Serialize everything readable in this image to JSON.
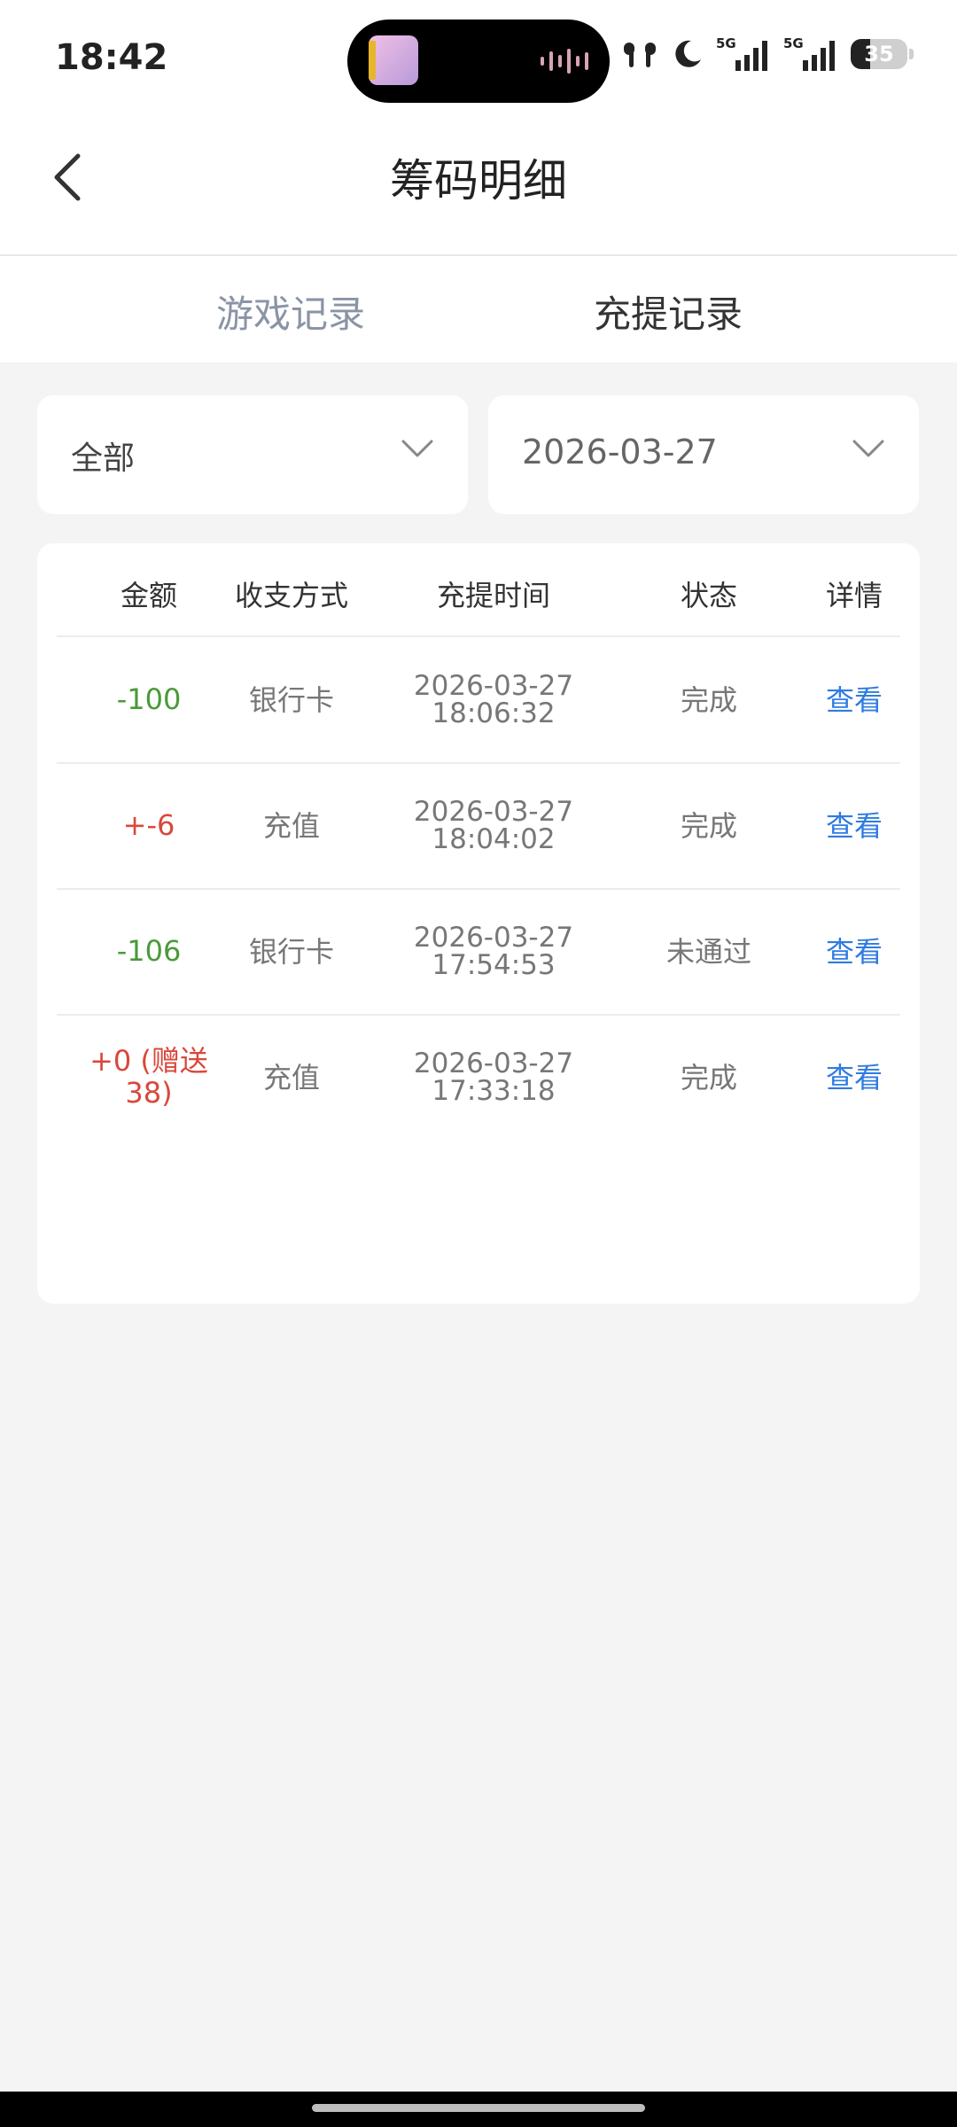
{
  "status_bar": {
    "time": "18:42",
    "icons": [
      "earbuds-icon",
      "moon-icon",
      "signal-5g-icon",
      "signal-5g-icon",
      "battery-icon"
    ],
    "signal_label_1": "5G",
    "signal_label_2": "5G",
    "battery": "35"
  },
  "header": {
    "title": "筹码明细",
    "back_icon": "chevron-left-icon"
  },
  "tabs": [
    {
      "label": "游戏记录",
      "active": false
    },
    {
      "label": "充提记录",
      "active": true
    }
  ],
  "filters": {
    "type": {
      "value": "全部",
      "icon": "chevron-down-icon"
    },
    "date": {
      "value": "2026-03-27",
      "icon": "chevron-down-icon"
    }
  },
  "table": {
    "columns": [
      "金额",
      "收支方式",
      "充提时间",
      "状态",
      "详情"
    ],
    "rows": [
      {
        "amount": "-100",
        "method": "银行卡",
        "date": "2026-03-27",
        "time": "18:06:32",
        "status": "完成",
        "detail": "查看"
      },
      {
        "amount": "+-6",
        "method": "充值",
        "date": "2026-03-27",
        "time": "18:04:02",
        "status": "完成",
        "detail": "查看"
      },
      {
        "amount": "-106",
        "method": "银行卡",
        "date": "2026-03-27",
        "time": "17:54:53",
        "status": "未通过",
        "detail": "查看"
      },
      {
        "amount": "+0 (赠送38)",
        "method": "充值",
        "date": "2026-03-27",
        "time": "17:33:18",
        "status": "完成",
        "detail": "查看"
      }
    ]
  },
  "colors": {
    "negative": "#4a9a3a",
    "positive": "#d9483b",
    "link": "#2f7be0",
    "inactive_tab": "#8a94a6"
  }
}
